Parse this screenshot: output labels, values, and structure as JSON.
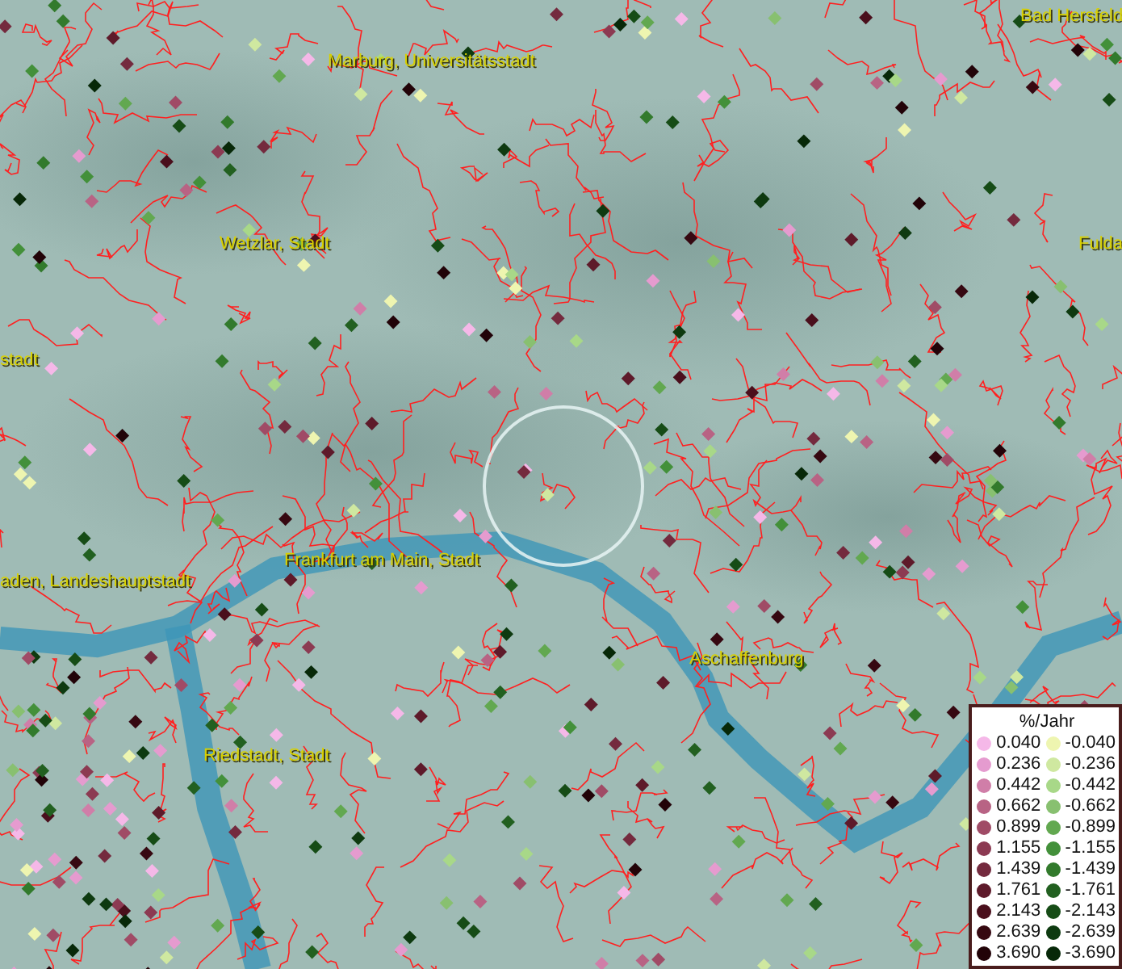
{
  "map": {
    "place_labels": [
      {
        "name": "Bad Hersfeld"
      },
      {
        "name": "Marburg, Universitätsstadt"
      },
      {
        "name": "Wetzlar, Stadt"
      },
      {
        "name": "Fulda"
      },
      {
        "name": "stadt"
      },
      {
        "name": "aden, Landeshauptstadt"
      },
      {
        "name": "Frankfurt am Main, Stadt"
      },
      {
        "name": "Aschaffenburg"
      },
      {
        "name": "Riedstadt, Stadt"
      }
    ]
  },
  "legend": {
    "title": "%/Jahr",
    "rows": [
      {
        "positive": {
          "label": "0.040",
          "color": "#f5b8e8"
        },
        "negative": {
          "label": "-0.040",
          "color": "#eef5b0"
        }
      },
      {
        "positive": {
          "label": "0.236",
          "color": "#e59bcf"
        },
        "negative": {
          "label": "-0.236",
          "color": "#cfe8a0"
        }
      },
      {
        "positive": {
          "label": "0.442",
          "color": "#d07ea8"
        },
        "negative": {
          "label": "-0.442",
          "color": "#a8d888"
        }
      },
      {
        "positive": {
          "label": "0.662",
          "color": "#b86384"
        },
        "negative": {
          "label": "-0.662",
          "color": "#88c070"
        }
      },
      {
        "positive": {
          "label": "0.899",
          "color": "#a04b66"
        },
        "negative": {
          "label": "-0.899",
          "color": "#62a850"
        }
      },
      {
        "positive": {
          "label": "1.155",
          "color": "#8c3a52"
        },
        "negative": {
          "label": "-1.155",
          "color": "#43903a"
        }
      },
      {
        "positive": {
          "label": "1.439",
          "color": "#742a3e"
        },
        "negative": {
          "label": "-1.439",
          "color": "#327a2c"
        }
      },
      {
        "positive": {
          "label": "1.761",
          "color": "#5e1a2a"
        },
        "negative": {
          "label": "-1.761",
          "color": "#226020"
        }
      },
      {
        "positive": {
          "label": "2.143",
          "color": "#4a0f1c"
        },
        "negative": {
          "label": "-2.143",
          "color": "#164c16"
        }
      },
      {
        "positive": {
          "label": "2.639",
          "color": "#360811"
        },
        "negative": {
          "label": "-2.639",
          "color": "#0e3a10"
        }
      },
      {
        "positive": {
          "label": "3.690",
          "color": "#220308"
        },
        "negative": {
          "label": "-3.690",
          "color": "#072808"
        }
      }
    ]
  }
}
